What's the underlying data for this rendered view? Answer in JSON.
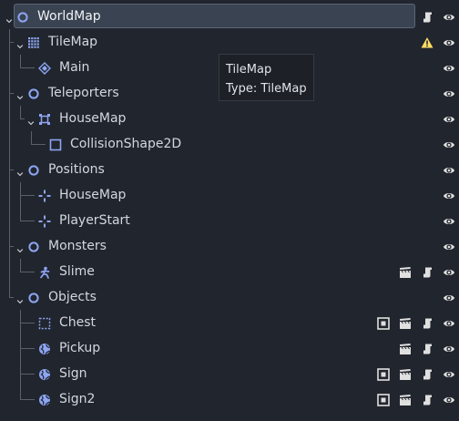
{
  "scene_tree": {
    "nodes": [
      {
        "id": "worldmap",
        "label": "WorldMap",
        "icon": "node2d-circle-icon",
        "depth": 0,
        "expanded": true,
        "selected": true,
        "last_child": true,
        "badges": [
          "script-icon",
          "visibility-eye-icon"
        ]
      },
      {
        "id": "tilemap",
        "label": "TileMap",
        "icon": "tilemap-grid-icon",
        "depth": 1,
        "expanded": true,
        "last_child": false,
        "badges": [
          "warning-icon",
          "visibility-eye-icon"
        ]
      },
      {
        "id": "main",
        "label": "Main",
        "icon": "tileset-layer-icon",
        "depth": 2,
        "last_child": true,
        "badges": [
          "visibility-eye-icon"
        ]
      },
      {
        "id": "teleporters",
        "label": "Teleporters",
        "icon": "node2d-circle-icon",
        "depth": 1,
        "expanded": true,
        "last_child": false,
        "badges": [
          "visibility-eye-icon"
        ]
      },
      {
        "id": "teleporters-housemap",
        "label": "HouseMap",
        "icon": "area2d-icon",
        "depth": 2,
        "expanded": true,
        "last_child": true,
        "badges": [
          "visibility-eye-icon"
        ]
      },
      {
        "id": "collisionshape2d",
        "label": "CollisionShape2D",
        "icon": "collision-shape-icon",
        "depth": 3,
        "last_child": true,
        "badges": [
          "visibility-eye-icon"
        ]
      },
      {
        "id": "positions",
        "label": "Positions",
        "icon": "node2d-circle-icon",
        "depth": 1,
        "expanded": true,
        "last_child": false,
        "badges": [
          "visibility-eye-icon"
        ]
      },
      {
        "id": "positions-housemap",
        "label": "HouseMap",
        "icon": "position2d-cross-icon",
        "depth": 2,
        "last_child": false,
        "badges": [
          "visibility-eye-icon"
        ]
      },
      {
        "id": "playerstart",
        "label": "PlayerStart",
        "icon": "position2d-cross-icon",
        "depth": 2,
        "last_child": true,
        "badges": [
          "visibility-eye-icon"
        ]
      },
      {
        "id": "monsters",
        "label": "Monsters",
        "icon": "node2d-circle-icon",
        "depth": 1,
        "expanded": true,
        "last_child": false,
        "badges": [
          "visibility-eye-icon"
        ]
      },
      {
        "id": "slime",
        "label": "Slime",
        "icon": "kinematic-body-icon",
        "depth": 2,
        "last_child": true,
        "badges": [
          "instance-clapper-icon",
          "script-icon",
          "visibility-eye-icon"
        ]
      },
      {
        "id": "objects",
        "label": "Objects",
        "icon": "node2d-circle-icon",
        "depth": 1,
        "expanded": true,
        "last_child": true,
        "badges": [
          "visibility-eye-icon"
        ]
      },
      {
        "id": "chest",
        "label": "Chest",
        "icon": "dotted-rect-icon",
        "depth": 2,
        "last_child": false,
        "badges": [
          "editable-children-icon",
          "instance-clapper-icon",
          "script-icon",
          "visibility-eye-icon"
        ]
      },
      {
        "id": "pickup",
        "label": "Pickup",
        "icon": "globe-icon",
        "depth": 2,
        "last_child": false,
        "badges": [
          "instance-clapper-icon",
          "script-icon",
          "visibility-eye-icon"
        ]
      },
      {
        "id": "sign",
        "label": "Sign",
        "icon": "globe-icon",
        "depth": 2,
        "last_child": false,
        "badges": [
          "editable-children-icon",
          "instance-clapper-icon",
          "script-icon",
          "visibility-eye-icon"
        ]
      },
      {
        "id": "sign2",
        "label": "Sign2",
        "icon": "globe-icon",
        "depth": 2,
        "last_child": true,
        "badges": [
          "editable-children-icon",
          "instance-clapper-icon",
          "script-icon",
          "visibility-eye-icon"
        ]
      }
    ]
  },
  "tooltip": {
    "line1": "TileMap",
    "line2": "Type: TileMap"
  },
  "colors": {
    "background": "#21252d",
    "selected_row": "#3a4352",
    "node_icon_blue": "#8da5f3",
    "warning": "#ffdd65",
    "icon_light": "#e0e0e0",
    "text": "#d3d7de"
  }
}
